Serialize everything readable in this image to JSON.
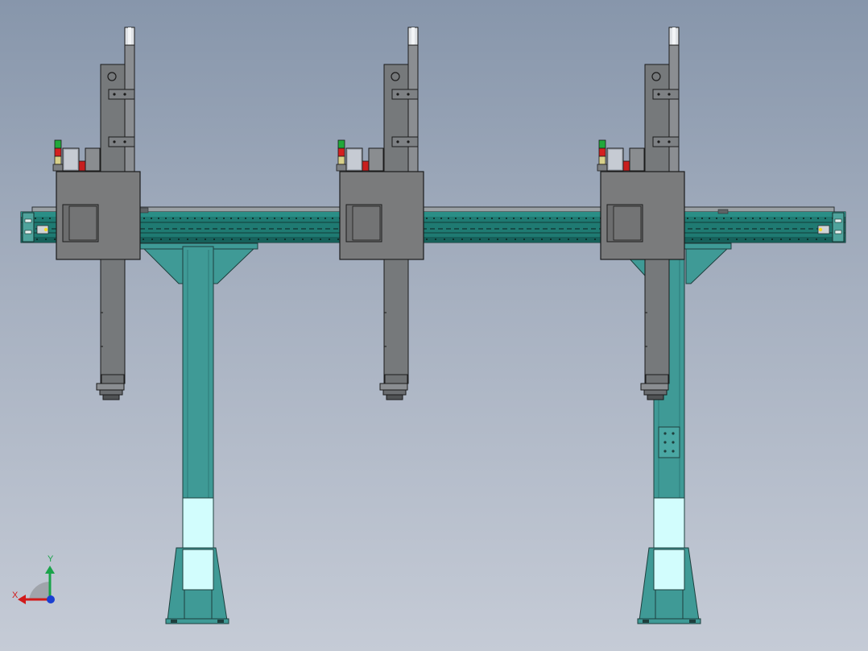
{
  "scene": {
    "view": "front",
    "background_top": "#8796ab",
    "background_bottom": "#c5cbd6",
    "frame_color": "#3f9a96",
    "frame_window_color": "#d2fdfd",
    "rail_color": "#1f7a72",
    "carriage_color": "#7a7b7c",
    "column_color": "#76797b",
    "beacon_colors": [
      "#22a83a",
      "#d42020",
      "#d8d08a"
    ]
  },
  "modules": [
    {
      "name": "carriage-left"
    },
    {
      "name": "carriage-middle"
    },
    {
      "name": "carriage-right"
    }
  ],
  "triad": {
    "x_label": "X",
    "y_label": "Y",
    "x_color": "#d11a1a",
    "y_color": "#1aa34a",
    "z_color": "#1a3fd1"
  }
}
